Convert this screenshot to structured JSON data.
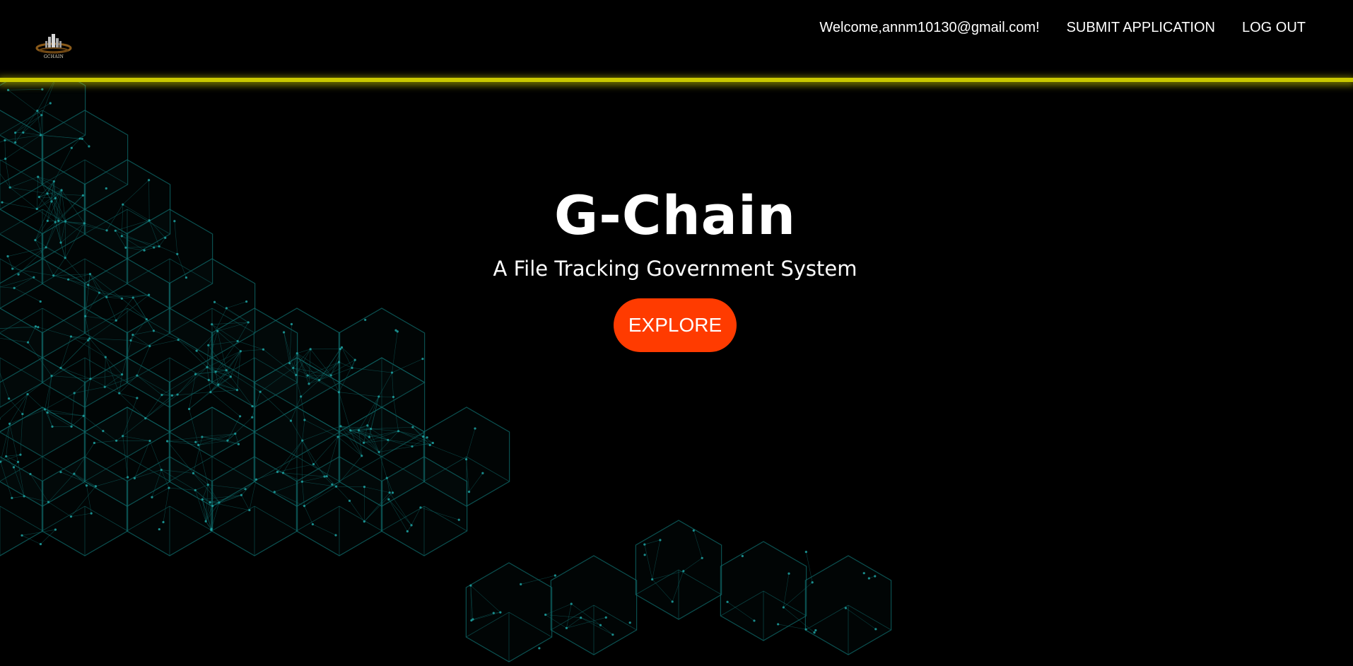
{
  "header": {
    "logo_text": "GCHAIN",
    "welcome_text": "Welcome,annm10130@gmail.com!",
    "nav": {
      "submit_label": "SUBMIT APPLICATION",
      "logout_label": "LOG OUT"
    }
  },
  "hero": {
    "title": "G-Chain",
    "subtitle": "A File Tracking Government System",
    "cta_label": "EXPLORE"
  },
  "colors": {
    "background": "#000000",
    "accent_bar": "#c9c800",
    "cta": "#ff3b00",
    "network_lines": "#0f6b6b"
  }
}
